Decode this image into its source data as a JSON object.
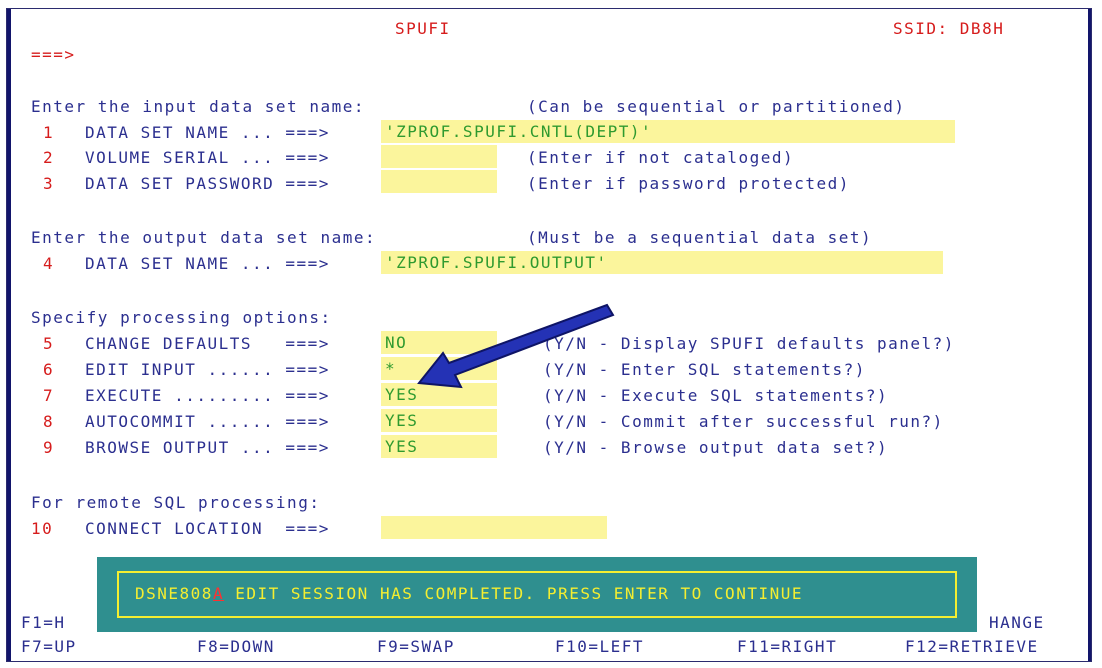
{
  "header": {
    "title": "SPUFI",
    "ssid": "SSID: DB8H",
    "command_prompt": "===>"
  },
  "input_section": {
    "heading": "Enter the input data set name:",
    "hint": "(Can be sequential or partitioned)",
    "fields": [
      {
        "num": "1",
        "label": "DATA SET NAME ... ===>",
        "value": "'ZPROF.SPUFI.CNTL(DEPT)'",
        "note": ""
      },
      {
        "num": "2",
        "label": "VOLUME SERIAL ... ===>",
        "value": "",
        "note": "(Enter if not cataloged)"
      },
      {
        "num": "3",
        "label": "DATA SET PASSWORD ===>",
        "value": "",
        "note": "(Enter if password protected)"
      }
    ]
  },
  "output_section": {
    "heading": "Enter the output data set name:",
    "hint": "(Must be a sequential data set)",
    "fields": [
      {
        "num": "4",
        "label": "DATA SET NAME ... ===>",
        "value": "'ZPROF.SPUFI.OUTPUT'"
      }
    ]
  },
  "options_section": {
    "heading": "Specify processing options:",
    "fields": [
      {
        "num": "5",
        "label": "CHANGE DEFAULTS   ===>",
        "value": "NO",
        "note": "(Y/N - Display SPUFI defaults panel?)"
      },
      {
        "num": "6",
        "label": "EDIT INPUT ...... ===>",
        "value": "*",
        "note": "(Y/N - Enter SQL statements?)"
      },
      {
        "num": "7",
        "label": "EXECUTE ......... ===>",
        "value": "YES",
        "note": "(Y/N - Execute SQL statements?)"
      },
      {
        "num": "8",
        "label": "AUTOCOMMIT ...... ===>",
        "value": "YES",
        "note": "(Y/N - Commit after successful run?)"
      },
      {
        "num": "9",
        "label": "BROWSE OUTPUT ... ===>",
        "value": "YES",
        "note": "(Y/N - Browse output data set?)"
      }
    ]
  },
  "remote_section": {
    "heading": "For remote SQL processing:",
    "fields": [
      {
        "num": "10",
        "label": "CONNECT LOCATION  ===>",
        "value": ""
      }
    ]
  },
  "message": {
    "id_prefix": "DSNE808",
    "id_cursor": "A",
    "text": " EDIT SESSION HAS COMPLETED. PRESS ENTER TO CONTINUE"
  },
  "pfkeys": {
    "row1_left": "F1=H",
    "row1_right": "HANGE",
    "row2": [
      "F7=UP",
      "F8=DOWN",
      "F9=SWAP",
      "F10=LEFT",
      "F11=RIGHT",
      "F12=RETRIEVE"
    ]
  },
  "colors": {
    "text_blue": "#2b2f8f",
    "number_red": "#d61c1c",
    "value_green": "#2f9a2f",
    "field_bg": "#fbf59c",
    "message_bg": "#2f8f8f",
    "message_text": "#f5ee30",
    "arrow": "#2432b5"
  },
  "annotation": {
    "icon": "pointer-arrow-icon"
  }
}
